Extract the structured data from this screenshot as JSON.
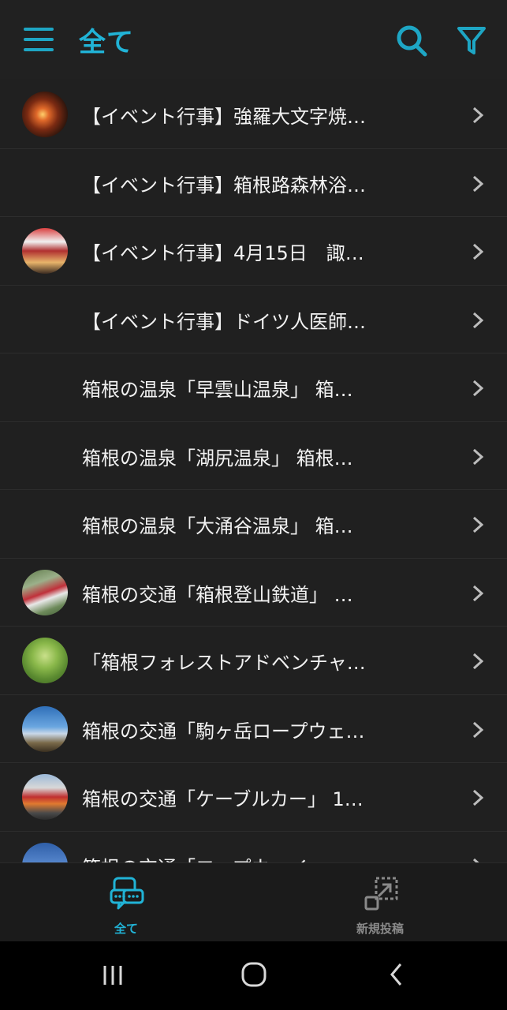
{
  "appbar": {
    "title": "全て",
    "menu_icon": "hamburger-icon",
    "search_icon": "search-icon",
    "filter_icon": "filter-icon",
    "accent": "#21b3d6"
  },
  "list": {
    "items": [
      {
        "title": "【イベント行事】強羅大文字焼…",
        "thumb": "fire-photo"
      },
      {
        "title": "【イベント行事】箱根路森林浴…",
        "thumb": ""
      },
      {
        "title": "【イベント行事】4月15日　諏…",
        "thumb": "festival-photo"
      },
      {
        "title": "【イベント行事】ドイツ人医師…",
        "thumb": ""
      },
      {
        "title": "箱根の温泉「早雲山温泉」 箱…",
        "thumb": ""
      },
      {
        "title": "箱根の温泉「湖尻温泉」 箱根…",
        "thumb": ""
      },
      {
        "title": "箱根の温泉「大涌谷温泉」 箱…",
        "thumb": ""
      },
      {
        "title": "箱根の交通「箱根登山鉄道」 …",
        "thumb": "train-photo"
      },
      {
        "title": "「箱根フォレストアドベンチャ…",
        "thumb": "forest-photo"
      },
      {
        "title": "箱根の交通「駒ヶ岳ロープウェ…",
        "thumb": "ropeway-photo"
      },
      {
        "title": "箱根の交通「ケーブルカー」 1…",
        "thumb": "cablecar-photo"
      },
      {
        "title": "箱根の交通「ロープウェイ」",
        "thumb": "sky-photo"
      }
    ]
  },
  "bottom_nav": {
    "tabs": [
      {
        "label": "全て",
        "icon": "chat-bubbles-icon",
        "active": true
      },
      {
        "label": "新規投稿",
        "icon": "new-post-icon",
        "active": false
      }
    ]
  },
  "system_nav": {
    "recent_icon": "recent-apps-icon",
    "home_icon": "home-icon",
    "back_icon": "back-icon"
  }
}
